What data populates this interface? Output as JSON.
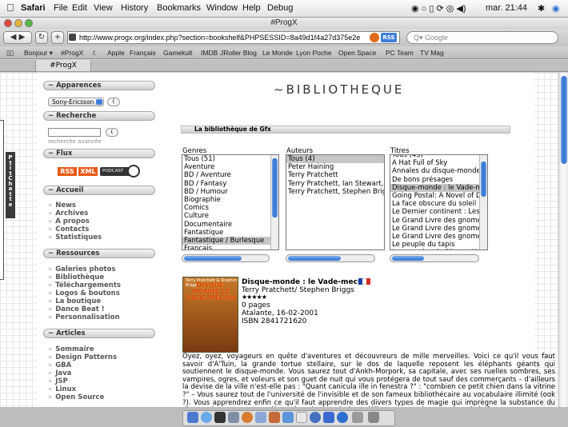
{
  "menubar": {
    "items": [
      "Safari",
      "File",
      "Edit",
      "View",
      "History",
      "Bookmarks",
      "Window",
      "Help",
      "Debug"
    ],
    "clock": "mar. 21:44"
  },
  "window": {
    "title": "#ProgX"
  },
  "toolbar": {
    "url": "http://www.progx.org/index.php?section=bookshelf&PHPSESSID=8a49d1f4a27d375e2e",
    "rss_label": "RSS",
    "search_placeholder": "Google"
  },
  "bookmarks": [
    "Bonjour ▾",
    "#ProgX",
    "/.",
    "Apple",
    "Français",
    "Gamekult",
    "IMDB",
    "JRoller Blog",
    "Le Monde",
    "Lyon Poche",
    "Open Space",
    "PC Team",
    "TV Mag"
  ],
  "tab": {
    "label": "#ProgX"
  },
  "sidebar": {
    "apparences": {
      "title": "~ Apparences",
      "theme_select": "Sony-Ericsson",
      "button": "("
    },
    "recherche": {
      "title": "~ Recherche",
      "button": "(",
      "advanced": "recherche avancée"
    },
    "flux": {
      "title": "~ Flux",
      "rss": "RSS",
      "xml": "XML",
      "podcast": "PODCAST"
    },
    "accueil": {
      "title": "~ Accueil",
      "items": [
        "News",
        "Archives",
        "A propos",
        "Contacts",
        "Statistiques"
      ]
    },
    "ressources": {
      "title": "~ Ressources",
      "items": [
        "Galeries photos",
        "Bibliothèque",
        "Téléchargements",
        "Logos & boutons",
        "La boutique",
        "Dance Beat !",
        "Personnalisation"
      ]
    },
    "articles": {
      "title": "~ Articles",
      "items": [
        "Sommaire",
        "Design Patterns",
        "GBA",
        "Java",
        "JSP",
        "Linux",
        "Open Source"
      ]
    },
    "chat_tab": "PtitChat"
  },
  "main": {
    "title": "~BIBLIOTHEQUE",
    "breadcrumb": "La bibliothèque de Gfx",
    "genres": {
      "label": "Genres",
      "items": [
        "Tous (51)",
        "Aventure",
        "BD / Aventure",
        "BD / Fantasy",
        "BD / Humour",
        "Biographie",
        "Comics",
        "Culture",
        "Documentaire",
        "Fantastique",
        "Fantastique / Burlesque",
        "Français"
      ],
      "selected": "Fantastique / Burlesque"
    },
    "auteurs": {
      "label": "Auteurs",
      "items": [
        "Tous (4)",
        "Peter Haining",
        "Terry Pratchett",
        "Terry Pratchett, Ian Stewart, J",
        "Terry Pratchett, Stephen Brigg"
      ],
      "selected": "Tous (4)"
    },
    "titres": {
      "label": "Titres",
      "items": [
        "Tous (43)",
        "A Hat Full of Sky",
        "Annales du disque-monde 0",
        "De bons présages",
        "Disque-monde : le Vade-me",
        "Going Postal: A Novel of Dis",
        "La face obscure du soleil",
        "Le Dernier continent : Les A",
        "Le Grand Livre des gnomes,",
        "Le Grand Livre des gnomes,",
        "Le Grand Livre des gnomes.",
        "Le peuple du tapis",
        "Les annales du Disque-Mon"
      ],
      "selected": "Disque-monde : le Vade-me"
    },
    "book": {
      "title": "Disque-monde : le Vade-mecum",
      "authors": "Terry Pratchett/ Stephen Briggs",
      "stars": "★★★★★",
      "pages": "0 pages",
      "publisher": "Atalante, 16-02-2001",
      "isbn": "ISBN 2841721620",
      "cover_text": "DISQUE-MONDE LE VADE-MECUM",
      "cover_author": "Terry Pratchett & Stephen Briggs",
      "description": "Oyez, oyez, voyageurs en quête d'aventures et découvreurs de mille merveilles. Voici ce qu'il vous faut savoir d'A'Tuin, la grande tortue stellaire, sur le dos de laquelle reposent les éléphants géants qui soutiennent le disque-monde. Vous saurez tout d'Ankh-Morpork, sa capitale, avec ses ruelles sombres, ses vampires, ogres, et voleurs et son guet de nuit qui vous protégera de tout sauf des commerçants – d'ailleurs la devise de la ville n'est-elle pas : \"Quant canicula ille in fenestra ?\" : \"combien ce petit chien dans la vitrine ?\" – Vous saurez tout de l'université de l'invisible et de son fameux bibliothécaire au vocabulaire illimité (ook ?). Vous apprendrez enfin ce qu'il faut apprendre des divers types de magie qui imprègne la substance du disque, des mages et sorcières, du pain de nain (met délicat et arme de guerre) ou de la fameuse"
    }
  }
}
